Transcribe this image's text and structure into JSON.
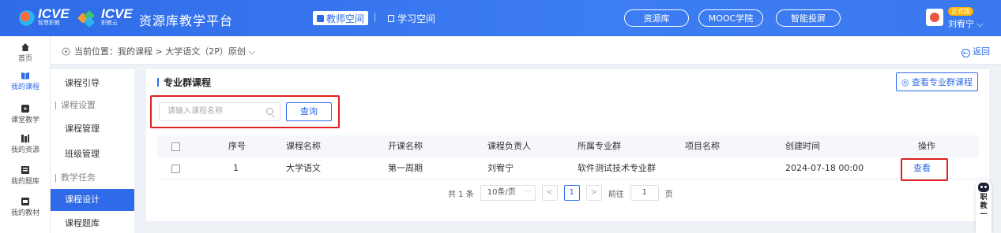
{
  "header": {
    "brand1_name": "ICVE",
    "brand1_sub": "智慧职教",
    "brand2_name": "ICVE",
    "brand2_sub": "职教云",
    "platform_title": "资源库教学平台",
    "teacher_space": "教师空间",
    "student_space": "学习空间",
    "nav_pills": [
      "资源库",
      "MOOC学院",
      "智能投屏"
    ],
    "badge": "正式版",
    "username": "刘宥宁 ⌵"
  },
  "leftnav": [
    {
      "label": "首页",
      "icon": "home-icon"
    },
    {
      "label": "我的课程",
      "icon": "book-icon"
    },
    {
      "label": "课堂教学",
      "icon": "play-icon"
    },
    {
      "label": "我的资源",
      "icon": "resource-icon"
    },
    {
      "label": "我的题库",
      "icon": "question-bank-icon"
    },
    {
      "label": "我的教材",
      "icon": "textbook-icon"
    }
  ],
  "breadcrumb": {
    "text": "当前位置：我的课程 > 大学语文（2P）原创 ⌵",
    "back": "返回"
  },
  "subnav": [
    {
      "label": "课程引导",
      "type": "item"
    },
    {
      "label": "课程设置",
      "type": "group"
    },
    {
      "label": "课程管理",
      "type": "item"
    },
    {
      "label": "班级管理",
      "type": "item"
    },
    {
      "label": "教学任务",
      "type": "group"
    },
    {
      "label": "课程设计",
      "type": "item",
      "active": true
    },
    {
      "label": "课程题库",
      "type": "item"
    }
  ],
  "main": {
    "title": "专业群课程",
    "view_group_btn": "◎ 查看专业群课程",
    "search_placeholder": "请输入课程名称",
    "query_btn": "查询",
    "columns": [
      "序号",
      "课程名称",
      "开课名称",
      "课程负责人",
      "所属专业群",
      "项目名称",
      "创建时间",
      "操作"
    ],
    "rows": [
      {
        "index": "1",
        "course": "大学语文",
        "offering": "第一周期",
        "owner": "刘宥宁",
        "group": "软件测试技术专业群",
        "project": "",
        "created": "2024-07-18 00:00",
        "action": "查看"
      }
    ]
  },
  "pager": {
    "total": "共 1 条",
    "page_size": "10条/页",
    "prev": "<",
    "current": "1",
    "next": ">",
    "goto_label": "前往",
    "goto_value": "1",
    "page_unit": "页"
  },
  "float_widget": {
    "text1": "职",
    "text2": "教",
    "text3": "一"
  },
  "colors": {
    "primary": "#2f6be8",
    "highlight_box": "#e02020"
  }
}
